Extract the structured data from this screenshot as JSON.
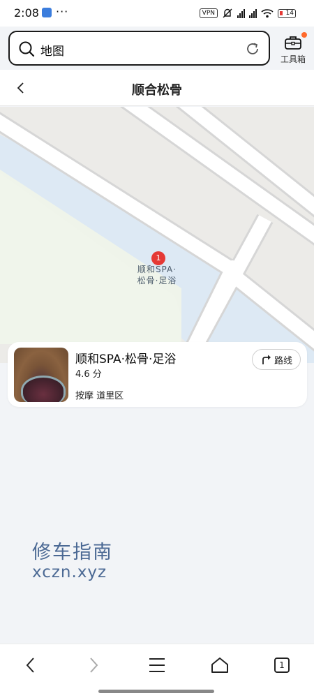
{
  "status_bar": {
    "time": "2:08",
    "more": "···",
    "vpn": "VPN",
    "battery": "14"
  },
  "search": {
    "value": "地图",
    "toolbox_label": "工具箱"
  },
  "page": {
    "title": "顺合松骨"
  },
  "map": {
    "marker_index": "1",
    "label_line1": "顺和SPA·",
    "label_line2": "松骨·足浴"
  },
  "poi": {
    "name": "顺和SPA·松骨·足浴",
    "rating": "4.6 分",
    "tags": "按摩 道里区",
    "route_label": "路线"
  },
  "watermark": {
    "cn": "修车指南",
    "url": "xczn.xyz"
  },
  "bottom_nav": {
    "tab_count": "1"
  },
  "colors": {
    "accent": "#e53935",
    "notification_dot": "#ff6a2c",
    "map_water": "#dde9f4",
    "map_green": "#eff4ea",
    "map_land": "#ecebe8",
    "watermark": "#3a5a8a"
  }
}
